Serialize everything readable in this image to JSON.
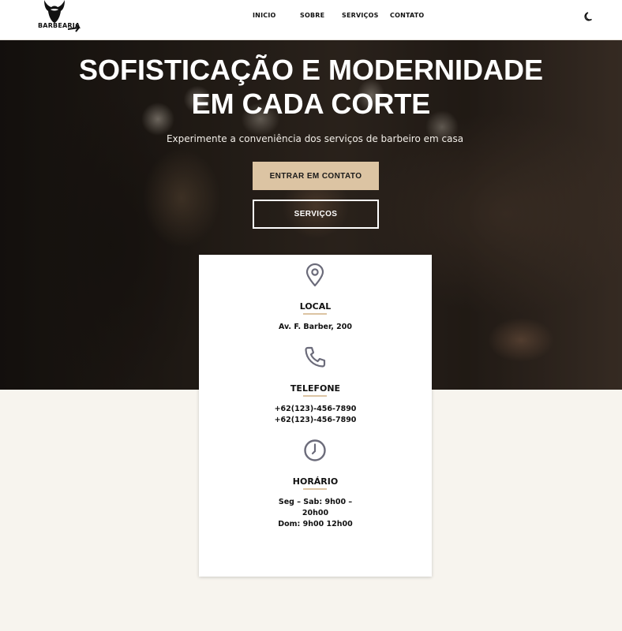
{
  "header": {
    "logo_text": "BARBEARIA",
    "nav": [
      {
        "label": "INICIO"
      },
      {
        "label": "SOBRE"
      },
      {
        "label": "SERVIÇOS"
      },
      {
        "label": "CONTATO"
      }
    ],
    "theme_toggle_icon": "moon-icon"
  },
  "hero": {
    "title_line1": "SOFISTICAÇÃO E MODERNIDADE",
    "title_line2": "EM CADA CORTE",
    "subtitle": "Experimente a conveniência dos serviços de barbeiro em casa",
    "primary_button": "ENTRAR EM CONTATO",
    "secondary_button": "SERVIÇOS"
  },
  "info_card": {
    "location": {
      "icon": "map-pin-icon",
      "label": "LOCAL",
      "lines": [
        "Av. F. Barber, 200"
      ]
    },
    "phone": {
      "icon": "phone-icon",
      "label": "TELEFONE",
      "lines": [
        "+62(123)-456-7890",
        "+62(123)-456-7890"
      ]
    },
    "hours": {
      "icon": "clock-icon",
      "label": "HORÁRIO",
      "lines": [
        "Seg – Sab: 9h00 –",
        "20h00",
        "Dom: 9h00 12h00"
      ]
    }
  },
  "colors": {
    "accent": "#dcc4a3",
    "page_background": "#f7f4ee",
    "icon": "#6b6b7a"
  }
}
